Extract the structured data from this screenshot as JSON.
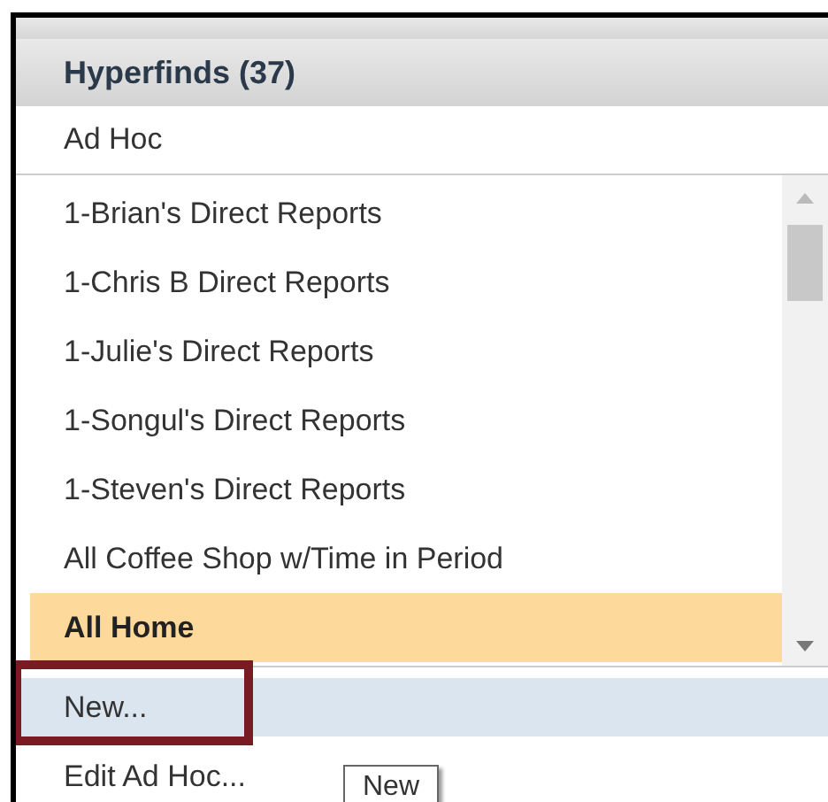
{
  "panel": {
    "title": "Hyperfinds (37)"
  },
  "group_label": "Ad Hoc",
  "items": [
    {
      "label": "1-Brian's Direct Reports",
      "selected": false
    },
    {
      "label": "1-Chris B Direct Reports",
      "selected": false
    },
    {
      "label": "1-Julie's Direct Reports",
      "selected": false
    },
    {
      "label": "1-Songul's Direct Reports",
      "selected": false
    },
    {
      "label": "1-Steven's Direct Reports",
      "selected": false
    },
    {
      "label": "All Coffee Shop w/Time in Period",
      "selected": false
    },
    {
      "label": "All Home",
      "selected": true
    }
  ],
  "menu": [
    {
      "label": "New...",
      "selected": true
    },
    {
      "label": "Edit Ad Hoc...",
      "selected": false
    }
  ],
  "tooltip": "New"
}
